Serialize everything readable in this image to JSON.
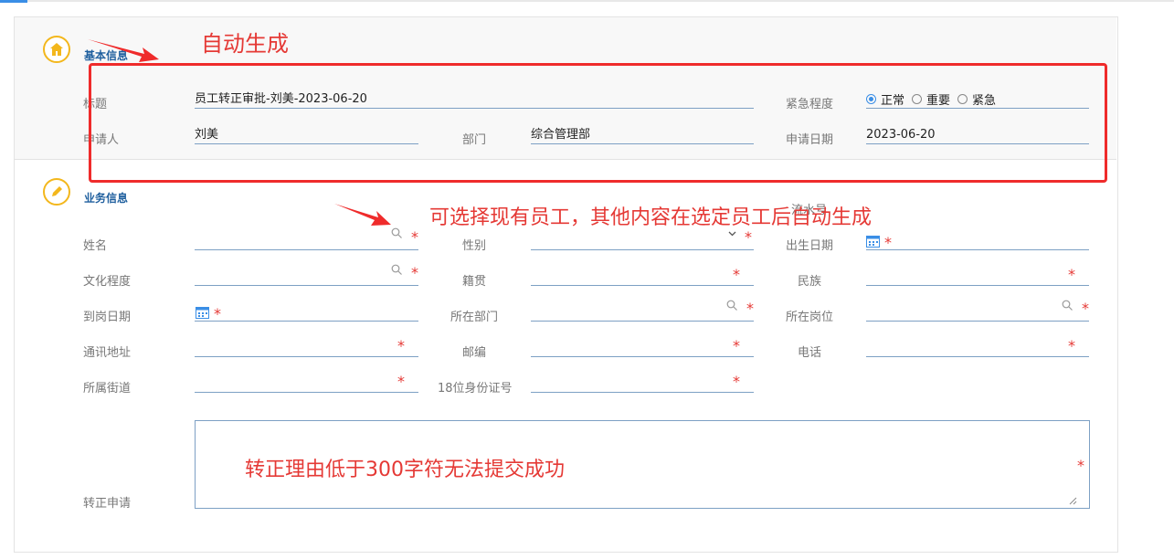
{
  "colors": {
    "accent": "#3a8ee6",
    "required": "#e53935",
    "section_title": "#1f5f9e",
    "icon_ring": "#f3b71c",
    "annotation": "#e53935"
  },
  "basic": {
    "section_title": "基本信息",
    "section_icon": "home-icon",
    "title_label": "标题",
    "title_value": "员工转正审批-刘美-2023-06-20",
    "urgency_label": "紧急程度",
    "urgency_options": [
      "正常",
      "重要",
      "紧急"
    ],
    "urgency_selected": "正常",
    "applicant_label": "申请人",
    "applicant_value": "刘美",
    "dept_label": "部门",
    "dept_value": "综合管理部",
    "date_label": "申请日期",
    "date_value": "2023-06-20"
  },
  "business": {
    "section_title": "业务信息",
    "section_icon": "edit-icon",
    "serial_label": "流水号",
    "required_mark": "*",
    "name_label": "姓名",
    "gender_label": "性别",
    "birth_label": "出生日期",
    "education_label": "文化程度",
    "native_label": "籍贯",
    "ethnic_label": "民族",
    "onboard_label": "到岗日期",
    "department_label": "所在部门",
    "position_label": "所在岗位",
    "address_label": "通讯地址",
    "postcode_label": "邮编",
    "phone_label": "电话",
    "street_label": "所属街道",
    "idcard_label": "18位身份证号",
    "reason_label": "转正申请"
  },
  "annotations": {
    "auto_generate": "自动生成",
    "select_employee": "可选择现有员工，其他内容在选定员工后自动生成",
    "reason_rule": "转正理由低于300字符无法提交成功"
  }
}
